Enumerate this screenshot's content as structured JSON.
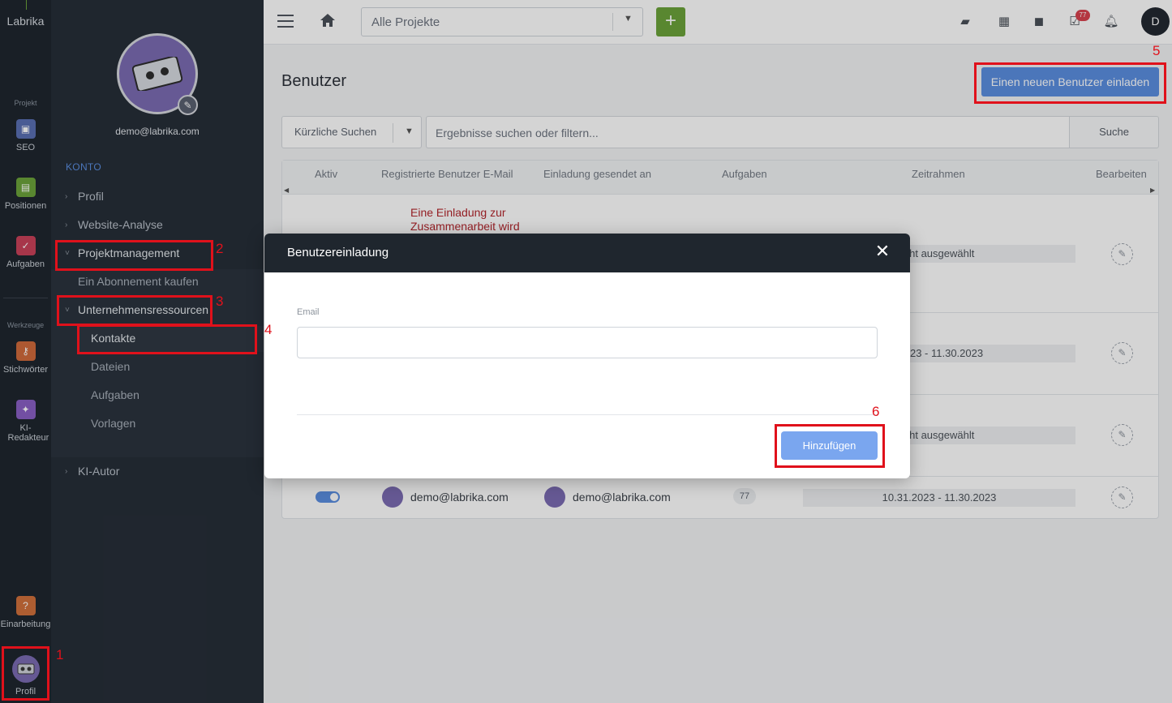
{
  "rail": {
    "brand": "Labrika",
    "section_project": "Projekt",
    "section_tools": "Werkzeuge",
    "items": [
      {
        "label": "SEO",
        "icon": "seo-icon",
        "color": "#5a6fb3"
      },
      {
        "label": "Positionen",
        "icon": "chart-icon",
        "color": "#6ba33a"
      },
      {
        "label": "Aufgaben",
        "icon": "check-icon",
        "color": "#c9425a"
      },
      {
        "label": "Stichwörter",
        "icon": "key-icon",
        "color": "#d06a3c"
      },
      {
        "label": "KI-Redakteur",
        "icon": "magic-wand-icon",
        "color": "#8a5fc4"
      },
      {
        "label": "Einarbeitung",
        "icon": "question-icon",
        "color": "#d0703c"
      },
      {
        "label": "Profil",
        "icon": "avatar-icon",
        "color": "#7b6bb3"
      }
    ]
  },
  "sidebar": {
    "email": "demo@labrika.com",
    "section": "KONTO",
    "items": {
      "profil": "Profil",
      "website_analyse": "Website-Analyse",
      "projektmanagement": "Projektmanagement",
      "abo": "Ein Abonnement kaufen",
      "unternehmensressourcen": "Unternehmensressourcen",
      "kontakte": "Kontakte",
      "dateien": "Dateien",
      "aufgaben": "Aufgaben",
      "vorlagen": "Vorlagen",
      "ki_autor": "KI-Autor"
    }
  },
  "topbar": {
    "project_select": "Alle Projekte",
    "add_label": "+",
    "notification_count": "77",
    "user_initial": "D"
  },
  "main": {
    "title": "Benutzer",
    "invite_button": "Einen neuen Benutzer einladen",
    "recent_search": "Kürzliche Suchen",
    "search_placeholder": "Ergebnisse suchen oder filtern...",
    "search_button": "Suche",
    "columns": [
      "Aktiv",
      "Registrierte Benutzer E-Mail",
      "Einladung gesendet an",
      "Aufgaben",
      "Zeitrahmen",
      "Bearbeiten"
    ],
    "rows": [
      {
        "note_line1": "Eine Einladung zur",
        "note_line2": "Zusammenarbeit wird",
        "timeframe": "cht ausgewählt"
      },
      {
        "timeframe": ".2023 - 11.30.2023"
      },
      {
        "timeframe": "cht ausgewählt"
      },
      {
        "email": "demo@labrika.com",
        "invited": "demo@labrika.com",
        "tasks": "77",
        "timeframe": "10.31.2023 - 11.30.2023"
      }
    ]
  },
  "modal": {
    "title": "Benutzereinladung",
    "email_label": "Email",
    "email_value": "",
    "submit": "Hinzufügen"
  },
  "annotations": [
    "1",
    "2",
    "3",
    "4",
    "5",
    "6"
  ],
  "colors": {
    "accent": "#5b8ee0",
    "annotation": "#e0111b",
    "dark": "#1f262e"
  }
}
